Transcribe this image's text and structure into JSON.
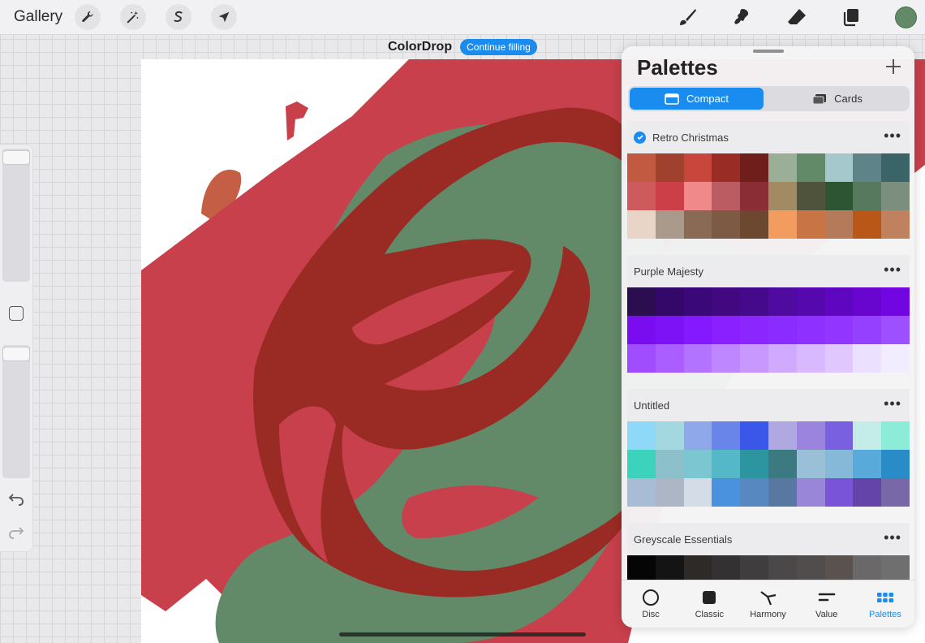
{
  "topbar": {
    "gallery_label": "Gallery",
    "left_tools": [
      {
        "name": "actions",
        "icon": "wrench-icon"
      },
      {
        "name": "adjustments",
        "icon": "magic-wand-icon"
      },
      {
        "name": "selection",
        "icon": "selection-s-icon"
      },
      {
        "name": "transform",
        "icon": "arrow-cursor-icon"
      }
    ],
    "right_tools": [
      {
        "name": "brush",
        "icon": "brush-icon"
      },
      {
        "name": "smudge",
        "icon": "smudge-icon"
      },
      {
        "name": "eraser",
        "icon": "eraser-icon"
      },
      {
        "name": "layers",
        "icon": "layers-icon"
      }
    ],
    "current_color": "#628a68"
  },
  "status": {
    "title": "ColorDrop",
    "action_label": "Continue filling"
  },
  "panel": {
    "title": "Palettes",
    "view_modes": {
      "active": "Compact",
      "inactive": "Cards"
    },
    "palettes": [
      {
        "name": "Retro Christmas",
        "is_default": true,
        "colors": [
          "#c15a40",
          "#a0412f",
          "#c9463c",
          "#992d26",
          "#6f1e1b",
          "#9aae98",
          "#638a68",
          "#a5c8cd",
          "#5e848a",
          "#3a6468",
          "#cd5a5c",
          "#cc3f48",
          "#f08a8a",
          "#bb5b62",
          "#8b2d35",
          "#a28b62",
          "#4f533b",
          "#2d5533",
          "#577a5e",
          "#7c8f7e",
          "#e8d5c8",
          "#aa9a8c",
          "#8a6a55",
          "#7d5a44",
          "#6d4830",
          "#f29c60",
          "#c97444",
          "#b57a5a",
          "#b95718",
          "#c0825e"
        ]
      },
      {
        "name": "Purple Majesty",
        "is_default": false,
        "colors": [
          "#2a0e50",
          "#330868",
          "#3a0878",
          "#41087f",
          "#450a8c",
          "#4f0aa0",
          "#5608af",
          "#5e06c0",
          "#6806d0",
          "#7206e0",
          "#7a0cf0",
          "#7e12f7",
          "#8418ff",
          "#8a20ff",
          "#8c26ff",
          "#8a2cff",
          "#8e30ff",
          "#9236ff",
          "#9640ff",
          "#9c50ff",
          "#a04cff",
          "#aa5eff",
          "#b274ff",
          "#be86ff",
          "#c898ff",
          "#d0aaff",
          "#d8b8ff",
          "#e0c8ff",
          "#ece0ff",
          "#f2ecff"
        ]
      },
      {
        "name": "Untitled",
        "is_default": false,
        "colors": [
          "#8ed9f7",
          "#a4d8e0",
          "#8fa8ea",
          "#6a85e9",
          "#3a57ea",
          "#b0a8e0",
          "#9b84dd",
          "#7860e0",
          "#c4ece8",
          "#8cecd8",
          "#3dd2bc",
          "#8cc1cb",
          "#7cc6d1",
          "#54b8c8",
          "#2d95a0",
          "#3a7a80",
          "#9ac0d8",
          "#86b8d8",
          "#58aada",
          "#2a8cc6",
          "#a8bcd6",
          "#acb6c4",
          "#d4dce8",
          "#4a92de",
          "#5888c0",
          "#5878a2",
          "#9a86d8",
          "#7a54d8",
          "#6444a8",
          "#7868a8"
        ]
      },
      {
        "name": "Greyscale Essentials",
        "is_default": false,
        "colors": [
          "#050505",
          "#141414",
          "#2e2a28",
          "#333131",
          "#3f3d3d",
          "#4a4848",
          "#514d4c",
          "#5a524e",
          "#6a6868",
          "#6f6f6f"
        ]
      }
    ],
    "tabs": [
      {
        "label": "Disc",
        "icon": "disc-icon"
      },
      {
        "label": "Classic",
        "icon": "classic-square-icon"
      },
      {
        "label": "Harmony",
        "icon": "harmony-icon"
      },
      {
        "label": "Value",
        "icon": "value-sliders-icon"
      },
      {
        "label": "Palettes",
        "icon": "palettes-grid-icon",
        "active": true
      }
    ]
  },
  "canvas_colors": {
    "red": "#c8404b",
    "dark_red": "#9a2b24",
    "green": "#638a68",
    "orange": "#c45f45"
  }
}
